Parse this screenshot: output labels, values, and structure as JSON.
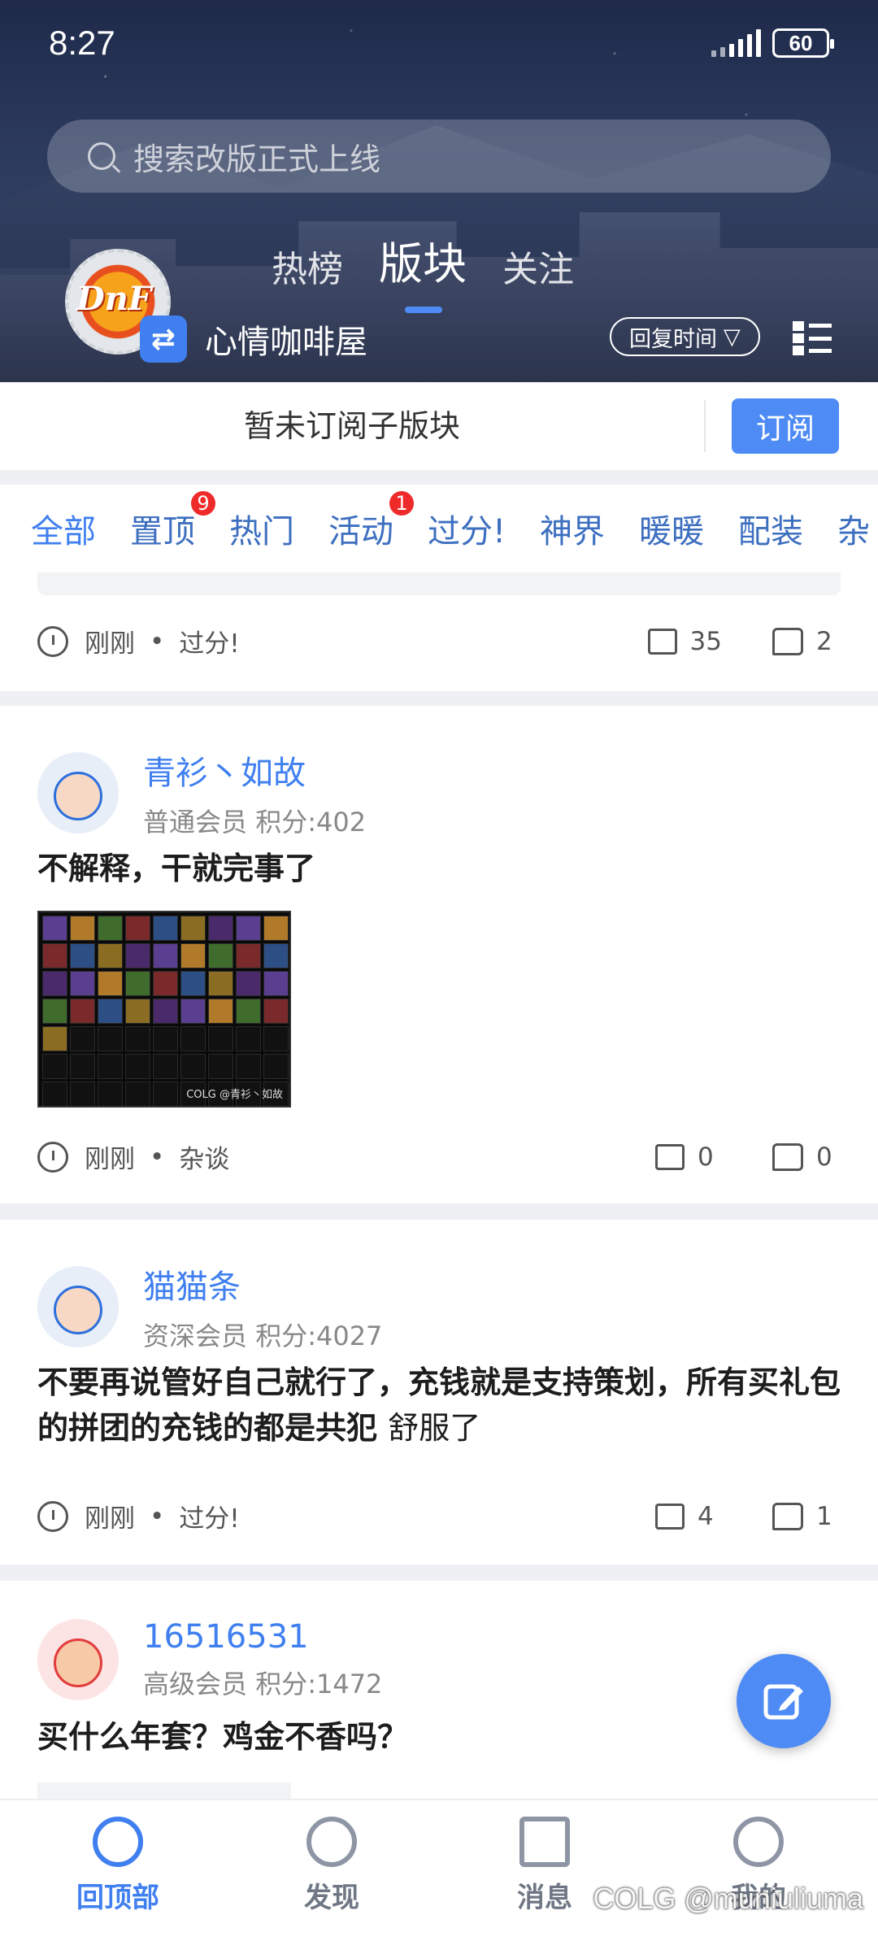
{
  "status_bar": {
    "time": "8:27",
    "battery": "60"
  },
  "search": {
    "placeholder": "搜索改版正式上线"
  },
  "top_tabs": [
    "热榜",
    "版块",
    "关注"
  ],
  "board": {
    "name": "心情咖啡屋",
    "sort_label": "回复时间"
  },
  "subscribe": {
    "message": "暂未订阅子版块",
    "button": "订阅"
  },
  "categories": [
    {
      "label": "全部"
    },
    {
      "label": "置顶",
      "badge": "9"
    },
    {
      "label": "热门"
    },
    {
      "label": "活动",
      "badge": "1"
    },
    {
      "label": "过分!"
    },
    {
      "label": "神界"
    },
    {
      "label": "暖暖"
    },
    {
      "label": "配装"
    },
    {
      "label": "杂"
    }
  ],
  "posts": [
    {
      "time": "刚刚",
      "category": "过分!",
      "comments": "35",
      "likes": "2"
    },
    {
      "user": "青衫丶如故",
      "level": "普通会员",
      "score": "积分:402",
      "title": "不解释，干就完事了",
      "image_watermark": "COLG @青衫丶如故",
      "time": "刚刚",
      "category": "杂谈",
      "comments": "0",
      "likes": "0"
    },
    {
      "user": "猫猫条",
      "level": "资深会员",
      "score": "积分:4027",
      "title": "不要再说管好自己就行了，充钱就是支持策划，所有买礼包的拼团的充钱的都是共犯",
      "title_tail": "舒服了",
      "time": "刚刚",
      "category": "过分!",
      "comments": "4",
      "likes": "1"
    },
    {
      "user": "16516531",
      "level": "高级会员",
      "score": "积分:1472",
      "title": "买什么年套？鸡金不香吗？"
    }
  ],
  "bottom_nav": [
    "回顶部",
    "发现",
    "消息",
    "我的"
  ],
  "watermark": "COLG @muniuliuma",
  "colors": {
    "accent": "#3f7ff0",
    "badge": "#ef2a2a"
  }
}
